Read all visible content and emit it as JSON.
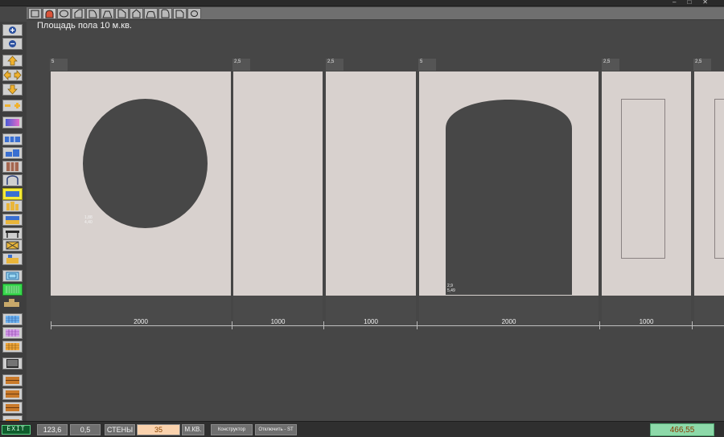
{
  "window": {
    "title": "",
    "controls": [
      "–",
      "□",
      "✕"
    ]
  },
  "toolbar_shapes": [
    {
      "name": "rect-shape-icon",
      "active": false
    },
    {
      "name": "arch-shape-icon",
      "active": true
    },
    {
      "name": "ellipse-shape-icon",
      "active": false
    },
    {
      "name": "slant-right-shape-icon",
      "active": false
    },
    {
      "name": "quarter-arc-shape-icon",
      "active": false
    },
    {
      "name": "trapezoid-shape-icon",
      "active": false
    },
    {
      "name": "slant-left-shape-icon",
      "active": false
    },
    {
      "name": "pentagon-shape-icon",
      "active": false
    },
    {
      "name": "trapezoid-arc-shape-icon",
      "active": false
    },
    {
      "name": "rounded-quarter-shape-icon",
      "active": false
    },
    {
      "name": "cut-corner-shape-icon",
      "active": false
    },
    {
      "name": "small-ellipse-shape-icon",
      "active": false
    }
  ],
  "header": {
    "floor_area": "Площадь пола 10 м.кв."
  },
  "panels": [
    {
      "tag": "5",
      "width": "2000",
      "cutout": "circle",
      "note_line1": "1,88",
      "note_line2": "4,40"
    },
    {
      "tag": "2,5",
      "width": "1000",
      "cutout": "none"
    },
    {
      "tag": "2,5",
      "width": "1000",
      "cutout": "none"
    },
    {
      "tag": "5",
      "width": "2000",
      "cutout": "arch",
      "note_line1": "2,9",
      "note_line2": "5,49"
    },
    {
      "tag": "2,5",
      "width": "1000",
      "cutout": "frame"
    },
    {
      "tag": "2,5",
      "width": "",
      "cutout": "frame"
    }
  ],
  "statusbar": {
    "exit_label": "EXIT",
    "value1": "123,6",
    "value2": "0,5",
    "walls_label": "СТЕНЫ",
    "walls_value": "35",
    "unit_label": "М.КВ.",
    "constructor_label": "Конструктор",
    "disable_label": "Отключить - ST",
    "total": "466,55"
  },
  "colors": {
    "background": "#464646",
    "panel": "#d8d1ce",
    "cutout": "#474747",
    "active_shape": "#d9543a",
    "highlight_yellow": "#f3e93a",
    "highlight_green": "#39d94e",
    "total_bg": "#8dd9a9",
    "input_bg": "#fad2ad"
  }
}
